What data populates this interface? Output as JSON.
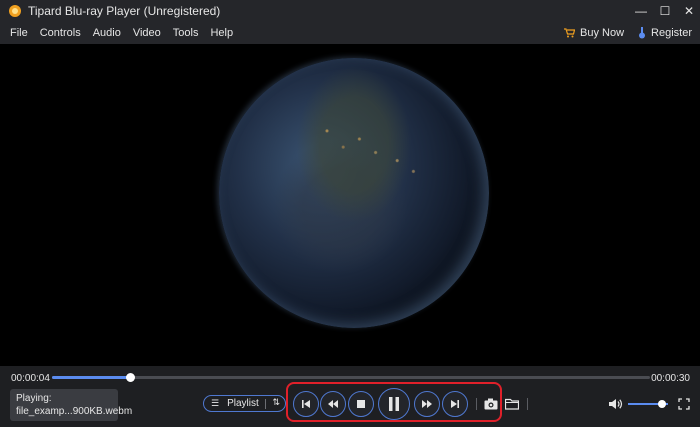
{
  "window": {
    "title": "Tipard Blu-ray Player (Unregistered)",
    "minimize_glyph": "—",
    "maximize_glyph": "☐",
    "close_glyph": "✕"
  },
  "menu": {
    "items": [
      "File",
      "Controls",
      "Audio",
      "Video",
      "Tools",
      "Help"
    ],
    "buy_now": "Buy Now",
    "register": "Register"
  },
  "player": {
    "current_time": "00:00:04",
    "total_time": "00:00:30",
    "progress_fraction": 0.13,
    "now_playing_label": "Playing:",
    "now_playing_file": "file_examp...900KB.webm",
    "playlist_label": "Playlist",
    "volume_fraction": 0.85
  },
  "colors": {
    "accent": "#5b8cf0",
    "highlight_frame": "#e0202a",
    "background": "#1e1f22"
  },
  "icons": {
    "controls": [
      "previous-track-icon",
      "rewind-icon",
      "stop-icon",
      "pause-icon",
      "fast-forward-icon",
      "next-track-icon"
    ],
    "tools": [
      "camera-icon",
      "folder-icon",
      "volume-icon",
      "fullscreen-icon"
    ]
  }
}
